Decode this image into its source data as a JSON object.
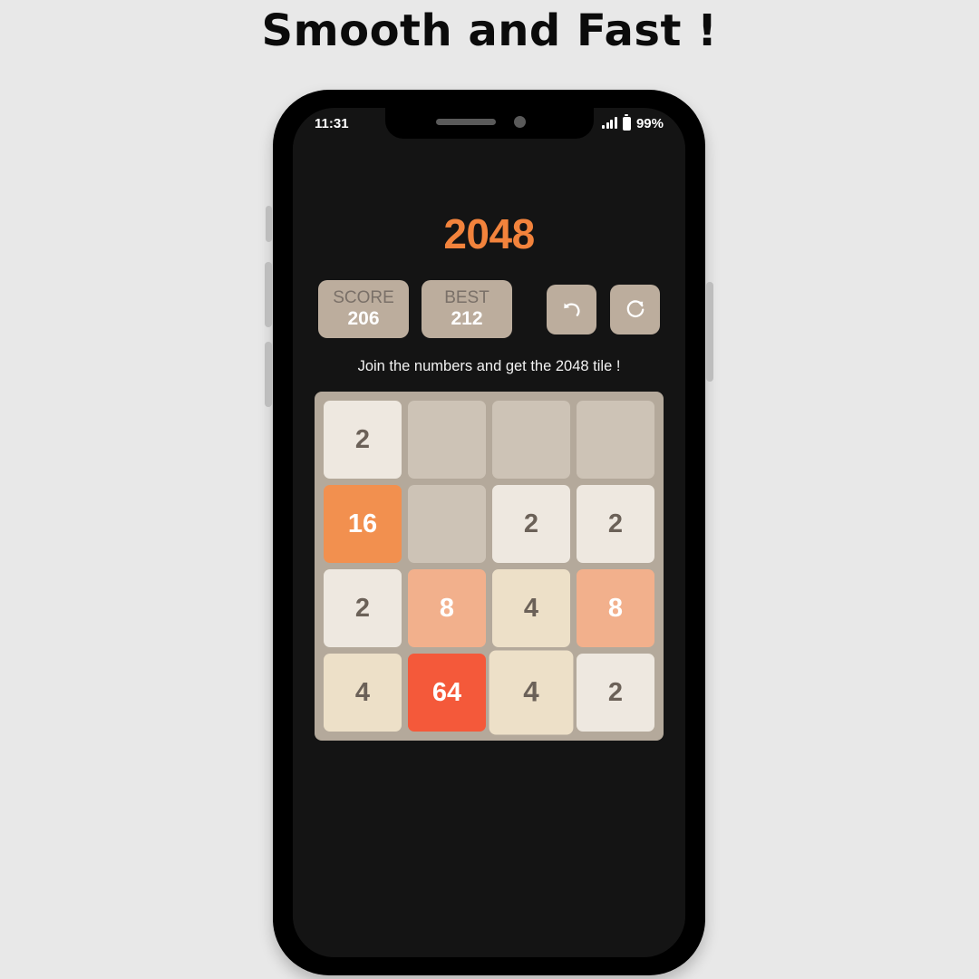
{
  "headline": "Smooth and Fast !",
  "status_bar": {
    "time": "11:31",
    "battery_percent": "99%",
    "signal_icon": "signal-bars-icon",
    "battery_icon": "battery-icon"
  },
  "app": {
    "logo": "2048",
    "tagline": "Join the numbers and get the 2048 tile !",
    "score": {
      "label": "SCORE",
      "value": "206"
    },
    "best": {
      "label": "BEST",
      "value": "212"
    },
    "undo_icon": "undo-icon",
    "restart_icon": "restart-icon"
  },
  "colors": {
    "page_bg": "#e8e8e8",
    "phone_frame": "#000000",
    "screen_bg": "#141414",
    "logo_orange": "#F2833C",
    "button_tan": "#BCAD9D",
    "board_bg": "#B4A99B",
    "empty_cell": "#CDC3B6",
    "tile_2": "#EEE8E0",
    "tile_4": "#EDE0C8",
    "tile_8": "#F2B08C",
    "tile_16": "#F2904F",
    "tile_64": "#F4593A",
    "tile_text_dark": "#6B6158",
    "tile_text_light": "#FFFFFF"
  },
  "board": {
    "rows": 4,
    "cols": 4,
    "tiles": [
      {
        "value": "2",
        "bg": "#EEE8E0",
        "fg": "#6B6158",
        "pop": false
      },
      {
        "value": "",
        "bg": "#CDC3B6",
        "fg": "#6B6158",
        "pop": false
      },
      {
        "value": "",
        "bg": "#CDC3B6",
        "fg": "#6B6158",
        "pop": false
      },
      {
        "value": "",
        "bg": "#CDC3B6",
        "fg": "#6B6158",
        "pop": false
      },
      {
        "value": "16",
        "bg": "#F2904F",
        "fg": "#FFFFFF",
        "pop": false
      },
      {
        "value": "",
        "bg": "#CDC3B6",
        "fg": "#6B6158",
        "pop": false
      },
      {
        "value": "2",
        "bg": "#EEE8E0",
        "fg": "#6B6158",
        "pop": false
      },
      {
        "value": "2",
        "bg": "#EEE8E0",
        "fg": "#6B6158",
        "pop": false
      },
      {
        "value": "2",
        "bg": "#EEE8E0",
        "fg": "#6B6158",
        "pop": false
      },
      {
        "value": "8",
        "bg": "#F2B08C",
        "fg": "#FFFFFF",
        "pop": false
      },
      {
        "value": "4",
        "bg": "#EDE0C8",
        "fg": "#6B6158",
        "pop": false
      },
      {
        "value": "8",
        "bg": "#F2B08C",
        "fg": "#FFFFFF",
        "pop": false
      },
      {
        "value": "4",
        "bg": "#EDE0C8",
        "fg": "#6B6158",
        "pop": false
      },
      {
        "value": "64",
        "bg": "#F4593A",
        "fg": "#FFFFFF",
        "pop": false
      },
      {
        "value": "4",
        "bg": "#EDE0C8",
        "fg": "#6B6158",
        "pop": true
      },
      {
        "value": "2",
        "bg": "#EEE8E0",
        "fg": "#6B6158",
        "pop": false
      }
    ]
  },
  "phone_hardware": {
    "silence_switch": "silence-switch",
    "volume_up": "volume-up-button",
    "volume_down": "volume-down-button",
    "power": "power-button"
  }
}
